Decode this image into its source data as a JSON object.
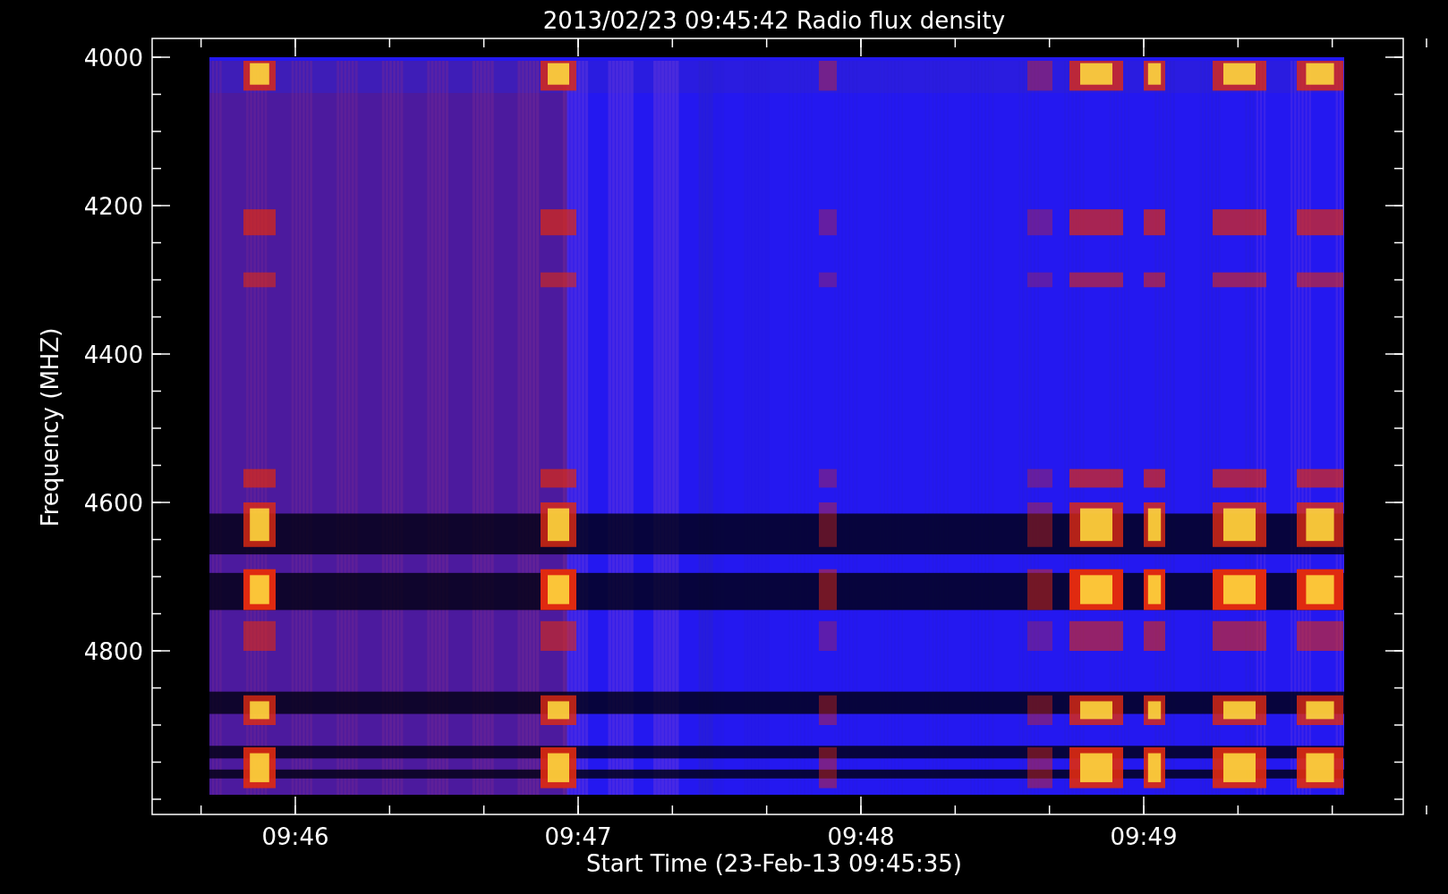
{
  "chart": {
    "title": "2013/02/23 09:45:42 Radio flux density",
    "xlabel": "Start Time (23-Feb-13 09:45:35)",
    "ylabel": "Frequency (MHZ)",
    "yticks": [
      "4000",
      "4200",
      "4400",
      "4600",
      "4800"
    ],
    "xticks": [
      "09:46",
      "09:47",
      "09:48",
      "09:49"
    ]
  }
}
